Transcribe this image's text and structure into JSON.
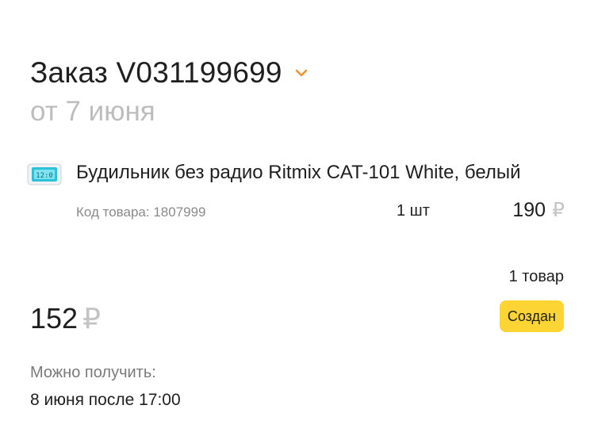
{
  "order": {
    "title": "Заказ V031199699",
    "date": "от 7 июня",
    "accent_color": "#f0912a"
  },
  "item": {
    "name": "Будильник без радио Ritmix CAT-101 White, белый",
    "code": "Код товара: 1807999",
    "qty": "1 шт",
    "price": "190",
    "currency": "₽",
    "thumbnail_icon": "alarm-clock-thumbnail"
  },
  "summary": {
    "items_count": "1 товар",
    "total": "152",
    "currency": "₽",
    "status": "Создан",
    "status_color": "#fcd535"
  },
  "pickup": {
    "label": "Можно получить:",
    "value": "8 июня после 17:00"
  }
}
